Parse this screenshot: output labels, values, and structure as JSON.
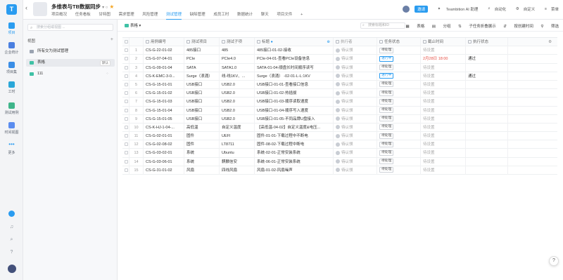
{
  "rail": {
    "logo": "T",
    "items": [
      {
        "label": "项目"
      },
      {
        "label": "企业统计"
      },
      {
        "label": "项目集"
      },
      {
        "label": "工时"
      },
      {
        "label": "测试用例"
      },
      {
        "label": "时间视图"
      },
      {
        "label": "更多"
      }
    ]
  },
  "header": {
    "title": "多维表与TB数据同步",
    "title_suffix": "▾  ○",
    "tabs": [
      "项目概况",
      "任务看板",
      "甘特图",
      "需求管理",
      "风险管理",
      "测试管理",
      "缺陷管理",
      "成员工时",
      "数据统计",
      "聊天",
      "项目文件",
      "+"
    ],
    "active_tab": "测试管理",
    "invite": "邀请",
    "ai": "Teambition AI 助理",
    "automation": "自动化",
    "custom": "自定义",
    "menu": "菜单"
  },
  "sidebar": {
    "search_placeholder": "搜索分组或视图 ...",
    "views_label": "视图",
    "add": "+",
    "items": [
      {
        "label": "所有交为测试管理",
        "badge": ""
      },
      {
        "label": "表格",
        "badge": "默认"
      },
      {
        "label": "111",
        "badge": ""
      }
    ]
  },
  "toolbar": {
    "view": "表格 ▾",
    "search_placeholder": "搜索标题和ID",
    "table": "表格",
    "group": "分组",
    "subtasks": "子任务折叠展示",
    "sort": "按创建时间",
    "filter": "筛选"
  },
  "grid": {
    "headers": [
      "",
      "",
      "用例编号",
      "测试项目",
      "测试子项",
      "标题",
      "执行者",
      "任务状态",
      "截止时间",
      "执行状态"
    ],
    "title_count": "●",
    "rows": [
      {
        "num": "1",
        "code": "CS-G-22-01-02",
        "item": "485接口",
        "sub": "485",
        "title": "485接口-01-02-接收",
        "exec": "待认领",
        "state": "待处理",
        "due": "待设置",
        "status": ""
      },
      {
        "num": "2",
        "code": "CS-G-07-04-01",
        "item": "PCIe",
        "sub": "PCIe4.0",
        "title": "PCIe-04-01-查看PCIe设备信息",
        "exec": "待认领",
        "state": "进行中",
        "due": "2月28日 18:00",
        "status": "通过"
      },
      {
        "num": "3",
        "code": "CS-G-09-01-04",
        "item": "SATA",
        "sub": "SATA1.0",
        "title": "SATA-01-04-顺盘长时间顺序读写",
        "exec": "待认领",
        "state": "待处理",
        "due": "待设置",
        "status": ""
      },
      {
        "num": "4",
        "code": "CS-K-EMC-3-0...",
        "item": "Surge（浪涌）",
        "sub": "线-线1KV、...",
        "title": "Surge（浪涌） -02-01-L-L:1KV",
        "exec": "待认领",
        "state": "进行中",
        "due": "待设置",
        "status": "通过"
      },
      {
        "num": "5",
        "code": "CS-G-15-01-01",
        "item": "USB接口",
        "sub": "USB2.0",
        "title": "USB接口-01-01-查看接口信息",
        "exec": "待认领",
        "state": "待处理",
        "due": "待设置",
        "status": ""
      },
      {
        "num": "6",
        "code": "CS-G-15-01-02",
        "item": "USB接口",
        "sub": "USB2.0",
        "title": "USB接口-01-02-热插拔",
        "exec": "待认领",
        "state": "待处理",
        "due": "待设置",
        "status": ""
      },
      {
        "num": "7",
        "code": "CS-G-15-01-03",
        "item": "USB接口",
        "sub": "USB2.0",
        "title": "USB接口-01-03-顺序读取速度",
        "exec": "待认领",
        "state": "待处理",
        "due": "待设置",
        "status": ""
      },
      {
        "num": "8",
        "code": "CS-G-15-01-04",
        "item": "USB接口",
        "sub": "USB2.0",
        "title": "USB接口-01-04-顺序写入速度",
        "exec": "待认领",
        "state": "待处理",
        "due": "待设置",
        "status": ""
      },
      {
        "num": "9",
        "code": "CS-G-15-01-05",
        "item": "USB接口",
        "sub": "USB2.0",
        "title": "USB接口-01-05-不同品牌U盘接入",
        "exec": "待认领",
        "state": "待处理",
        "due": "待设置",
        "status": ""
      },
      {
        "num": "10",
        "code": "CS-K-HJ-1-04-...",
        "item": "高低温",
        "sub": "自定义温度",
        "title": "【高低温-04-02】自定义温度&电压...",
        "exec": "待认领",
        "state": "待处理",
        "due": "待设置",
        "status": ""
      },
      {
        "num": "11",
        "code": "CS-G-02-01-01",
        "item": "固件",
        "sub": "UEFI",
        "title": "固件-01-01-下载过程中不断电",
        "exec": "待认领",
        "state": "待处理",
        "due": "待设置",
        "status": ""
      },
      {
        "num": "12",
        "code": "CS-G-02-08-02",
        "item": "固件",
        "sub": "LT8711",
        "title": "固件-08-02-下载过程中断电",
        "exec": "待认领",
        "state": "待处理",
        "due": "待设置",
        "status": ""
      },
      {
        "num": "13",
        "code": "CS-G-03-02-01",
        "item": "系统",
        "sub": "Ubuntu",
        "title": "系统-02-01-正常安装系统",
        "exec": "待认领",
        "state": "待处理",
        "due": "待设置",
        "status": ""
      },
      {
        "num": "14",
        "code": "CS-G-03-06-01",
        "item": "系统",
        "sub": "麒麟信安",
        "title": "系统-06-01-正常安装系统",
        "exec": "待认领",
        "state": "待处理",
        "due": "待设置",
        "status": ""
      },
      {
        "num": "15",
        "code": "CS-G-31-01-02",
        "item": "风扇",
        "sub": "四线风扇",
        "title": "风扇-01-02-风扇噪声",
        "exec": "待认领",
        "state": "待处理",
        "due": "待设置",
        "status": ""
      }
    ]
  },
  "help": "?"
}
